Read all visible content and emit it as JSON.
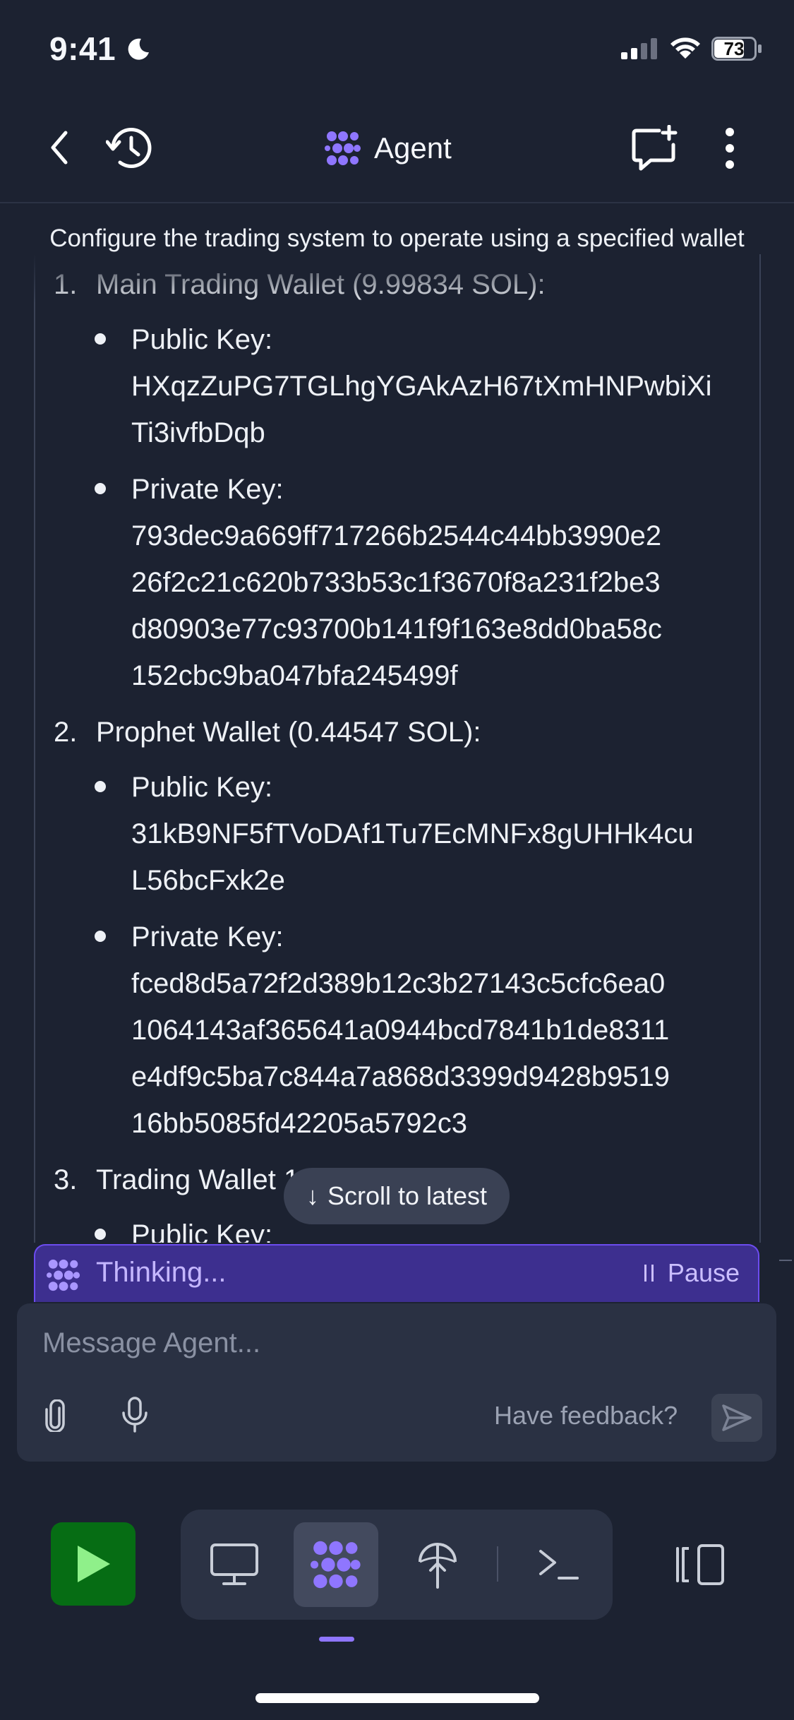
{
  "status_bar": {
    "time": "9:41",
    "battery": "73"
  },
  "header": {
    "title": "Agent"
  },
  "task": {
    "title": "Configure the trading system to operate using a specified wallet"
  },
  "wallets": [
    {
      "number": "1.",
      "heading": "Main Trading Wallet (9.99834 SOL):",
      "public_label": "Public Key:",
      "public_key_lines": [
        "HXqzZuPG7TGLhgYGAkAzH67tXmHNPwbiXi",
        "Ti3ivfbDqb"
      ],
      "private_label": "Private Key:",
      "private_key_lines": [
        "793dec9a669ff717266b2544c44bb3990e2",
        "26f2c21c620b733b53c1f3670f8a231f2be3",
        "d80903e77c93700b141f9f163e8dd0ba58c",
        "152cbc9ba047bfa245499f"
      ]
    },
    {
      "number": "2.",
      "heading": "Prophet Wallet (0.44547 SOL):",
      "public_label": "Public Key:",
      "public_key_lines": [
        "31kB9NF5fTVoDAf1Tu7EcMNFx8gUHHk4cu",
        "L56bcFxk2e"
      ],
      "private_label": "Private Key:",
      "private_key_lines": [
        "fced8d5a72f2d389b12c3b27143c5cfc6ea0",
        "1064143af365641a0944bcd7841b1de8311",
        "e4df9c5ba7c844a7a868d3399d9428b9519",
        "16bb5085fd42205a5792c3"
      ]
    },
    {
      "number": "3.",
      "heading": "Trading Wallet 1",
      "public_label": "Public Key:"
    }
  ],
  "scroll_latest": {
    "label": "Scroll to latest",
    "arrow": "↓"
  },
  "thinking": {
    "label": "Thinking...",
    "pause_label": "Pause"
  },
  "composer": {
    "placeholder": "Message Agent...",
    "feedback_label": "Have feedback?"
  },
  "colors": {
    "accent": "#8f76ff",
    "run_green": "#066d14",
    "thinking_bg": "#3d2f8f",
    "background": "#1c2231"
  }
}
